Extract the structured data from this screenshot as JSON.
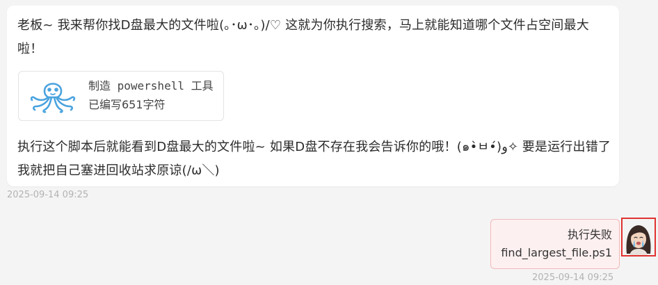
{
  "assistant_message": {
    "intro_text": "老板~ 我来帮你找D盘最大的文件啦(｡･ω･｡)/♡ 这就为你执行搜索，马上就能知道哪个文件占空间最大啦！",
    "tool_card": {
      "icon": "octopus-icon",
      "title": "制造 powershell 工具",
      "subtitle": "已编写651字符"
    },
    "outro_text": "执行这个脚本后就能看到D盘最大的文件啦~ 如果D盘不存在我会告诉你的哦！(๑•̀ㅂ•́)و✧ 要是运行出错了我就把自己塞进回收站求原谅(/ω＼)",
    "timestamp": "2025-09-14 09:25"
  },
  "user_message": {
    "status_text": "执行失败",
    "file_name": "find_largest_file.ps1",
    "timestamp": "2025-09-14 09:25",
    "avatar_icon": "user-avatar"
  },
  "colors": {
    "page_background": "#f4f4f5",
    "assistant_bubble": "#ffffff",
    "user_bubble_background": "#fdf0f0",
    "user_bubble_border": "#f2b8b8",
    "avatar_highlight_border": "#e0322f",
    "octopus_icon": "#4aa3df",
    "timestamp_text": "#b3b3b3"
  }
}
